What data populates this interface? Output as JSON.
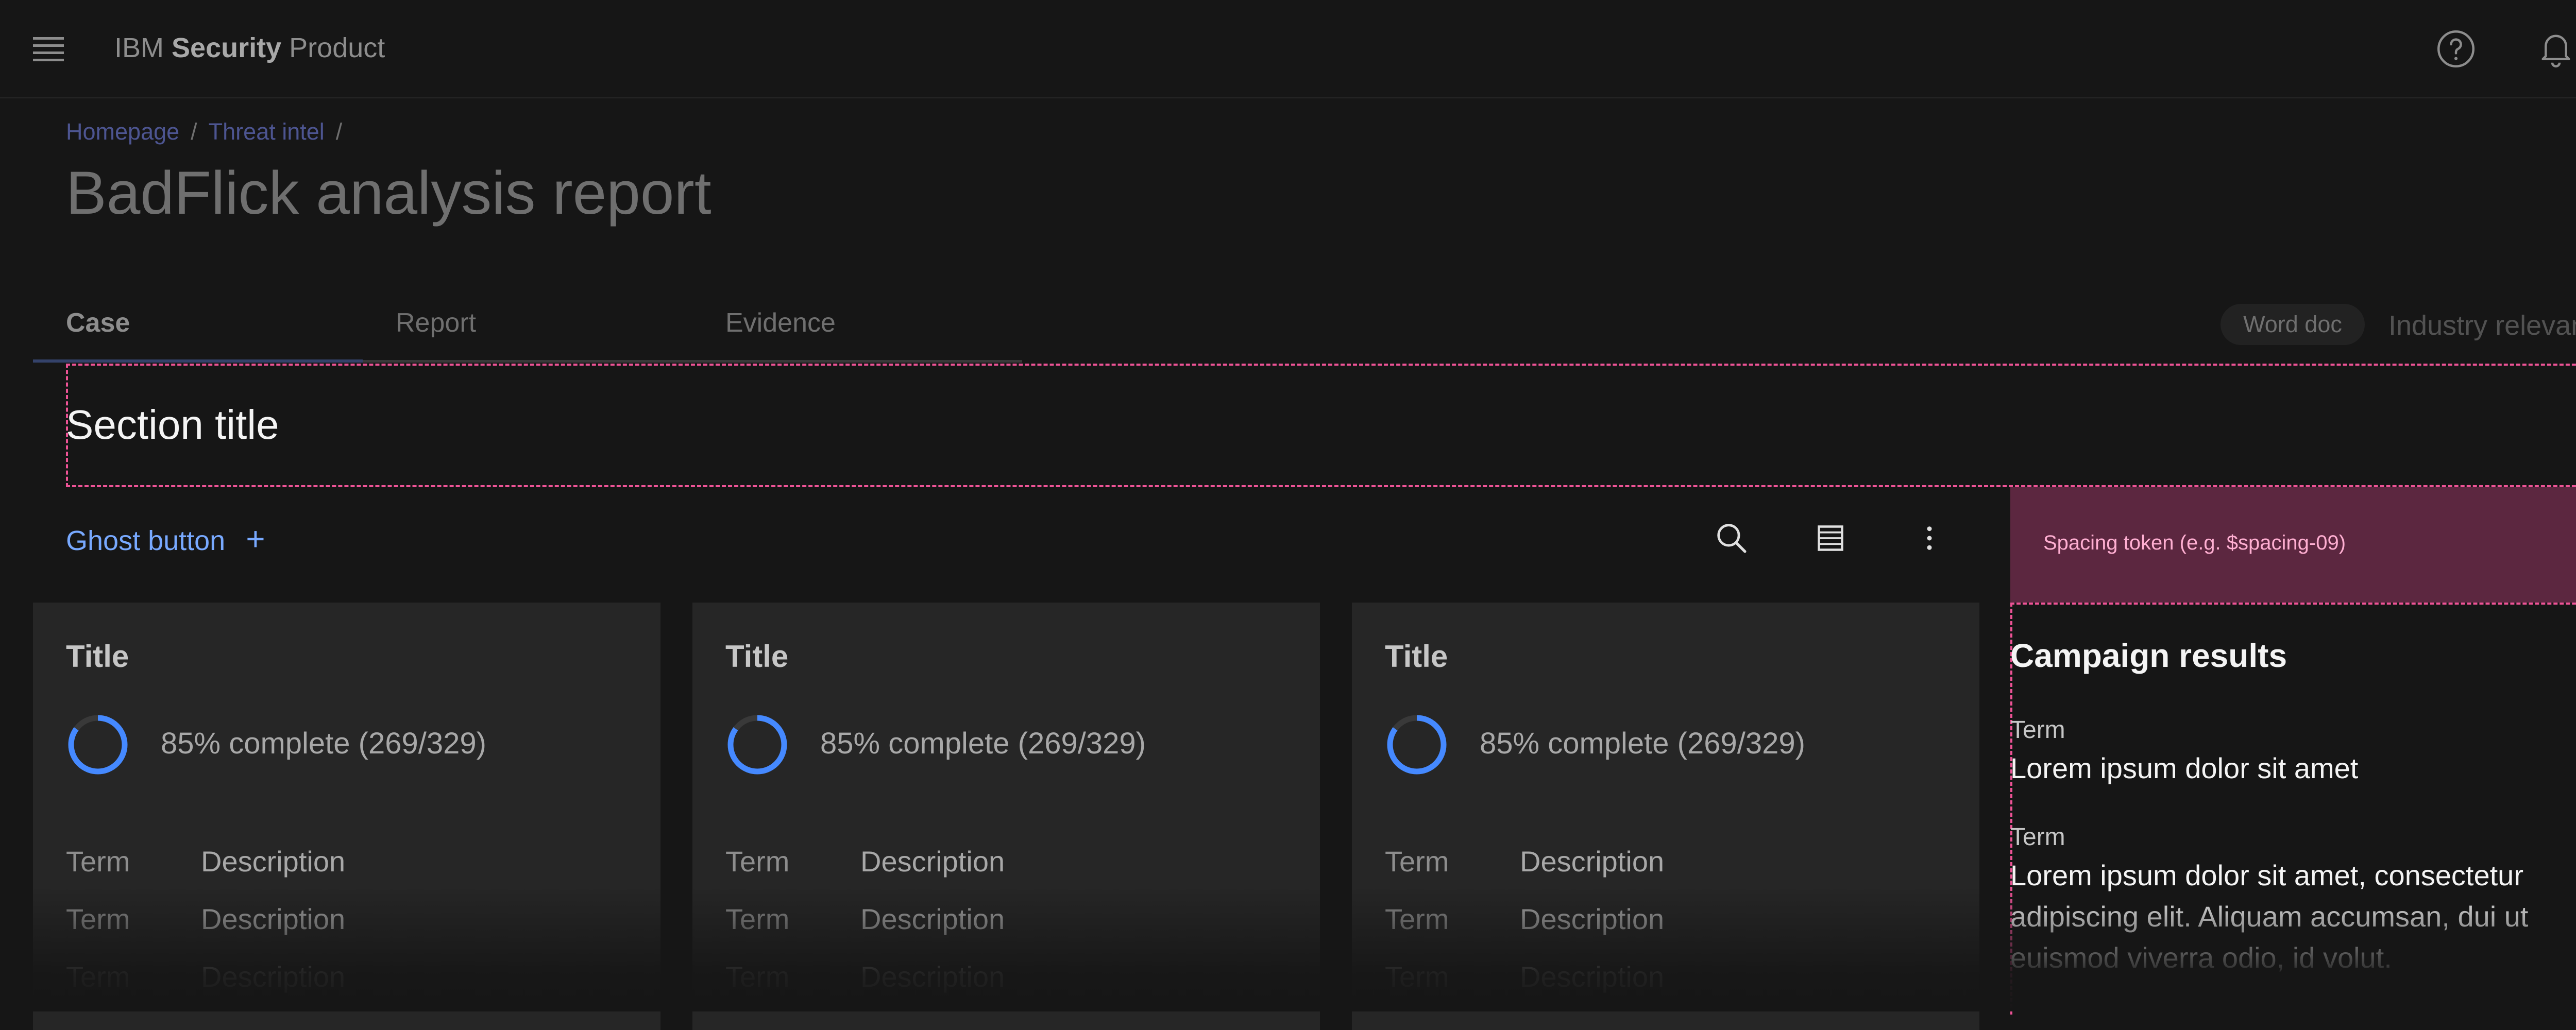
{
  "header": {
    "brand_prefix": "IBM",
    "brand_bold": "Security",
    "brand_suffix": "Product",
    "icons": [
      "menu-icon",
      "help-icon",
      "notification-icon",
      "avatar"
    ]
  },
  "breadcrumb": {
    "items": [
      "Homepage",
      "Threat intel"
    ],
    "separator": "/"
  },
  "page_title": "BadFlick analysis report",
  "tabs": [
    {
      "label": "Case",
      "active": true
    },
    {
      "label": "Report",
      "active": false
    },
    {
      "label": "Evidence",
      "active": false
    }
  ],
  "tag": "Word doc",
  "industry_label": "Industry relevancy",
  "section_title": "Section title",
  "toolbar": {
    "ghost_label": "Ghost button",
    "ghost_icon": "+",
    "icons": [
      "search-icon",
      "table-icon",
      "overflow-menu-icon"
    ]
  },
  "spacing_token": "Spacing token (e.g. $spacing-09)",
  "cards": [
    {
      "title": "Title",
      "progress_text": "85% complete (269/329)",
      "progress": 0.85,
      "rows": [
        {
          "term": "Term",
          "desc": "Description"
        },
        {
          "term": "Term",
          "desc": "Description"
        },
        {
          "term": "Term",
          "desc": "Description"
        }
      ]
    },
    {
      "title": "Title",
      "progress_text": "85% complete (269/329)",
      "progress": 0.85,
      "rows": [
        {
          "term": "Term",
          "desc": "Description"
        },
        {
          "term": "Term",
          "desc": "Description"
        },
        {
          "term": "Term",
          "desc": "Description"
        }
      ]
    },
    {
      "title": "Title",
      "progress_text": "85% complete (269/329)",
      "progress": 0.85,
      "rows": [
        {
          "term": "Term",
          "desc": "Description"
        },
        {
          "term": "Term",
          "desc": "Description"
        },
        {
          "term": "Term",
          "desc": "Description"
        }
      ]
    }
  ],
  "campaign": {
    "title": "Campaign results",
    "items": [
      {
        "term": "Term",
        "value": "Lorem ipsum dolor sit amet"
      },
      {
        "term": "Term",
        "value": "Lorem ipsum dolor sit amet, consectetur adipiscing elit. Aliquam accumsan, dui ut euismod viverra odio, id volut."
      }
    ]
  },
  "colors": {
    "background": "#161616",
    "accent_blue": "#78a9ff",
    "progress_blue": "#4589ff",
    "highlight_pink": "#ee5396",
    "token_fill": "#5c2740"
  }
}
